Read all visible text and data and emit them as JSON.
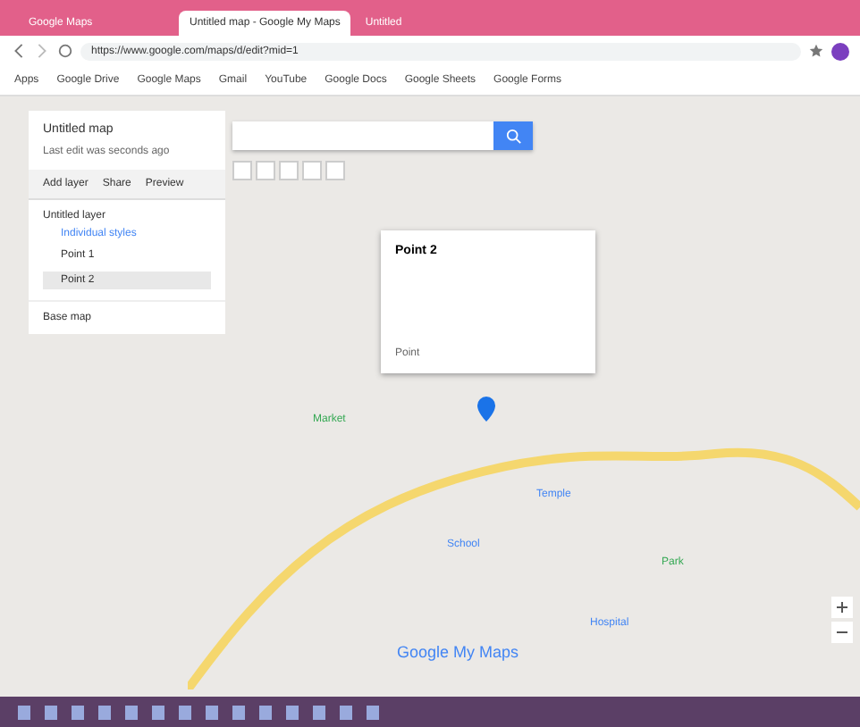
{
  "browser": {
    "tabs": [
      {
        "title": "Google Maps",
        "selected": false
      },
      {
        "title": "Untitled map - Google My Maps",
        "selected": true
      },
      {
        "title": "Untitled",
        "selected": false
      }
    ],
    "url": "https://www.google.com/maps/d/edit?mid=1",
    "bookmarks": [
      "Apps",
      "Google Drive",
      "Google Maps",
      "Gmail",
      "YouTube",
      "Google Docs",
      "Google Sheets",
      "Google Forms"
    ]
  },
  "panel": {
    "title": "Untitled map",
    "subtitle": "Last edit was seconds ago",
    "actions": [
      "Add layer",
      "Share",
      "Preview"
    ],
    "layer": {
      "name": "Untitled layer",
      "style": "Individual styles",
      "items": [
        {
          "label": "Point 1",
          "selected": false
        },
        {
          "label": "Point 2",
          "selected": true
        }
      ]
    },
    "base_map": "Base map"
  },
  "popup": {
    "title": "Point 2",
    "footer": "Point"
  },
  "map": {
    "labels": [
      {
        "text": "Market",
        "kind": "green"
      },
      {
        "text": "Temple",
        "kind": "blue"
      },
      {
        "text": "School",
        "kind": "blue"
      },
      {
        "text": "Hospital",
        "kind": "blue"
      },
      {
        "text": "Park",
        "kind": "green"
      }
    ],
    "logo": "Google My Maps"
  }
}
